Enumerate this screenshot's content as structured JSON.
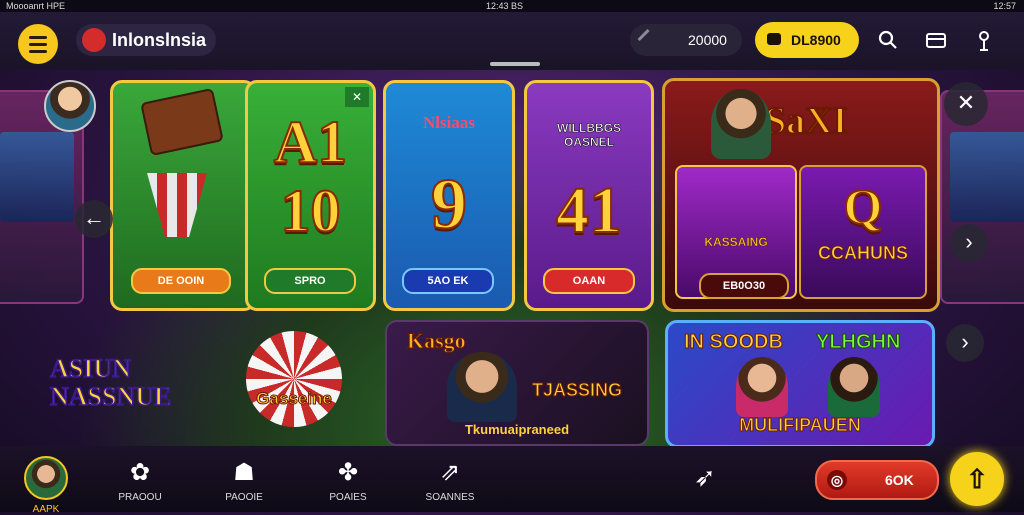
{
  "status_bar": {
    "left": "Moooanrt HPE",
    "center": "12:43 BS",
    "right": "12:57"
  },
  "header": {
    "brand": "Inlonslnsia",
    "coins": "20000",
    "gold_balance": "DL8900",
    "icons": [
      "search-icon",
      "wallet-icon",
      "info-icon"
    ]
  },
  "games_top": [
    {
      "id": "dice",
      "button": "DE OOIN",
      "colors": {
        "bg": "#2e8a2a",
        "btn": "#e87a1a"
      }
    },
    {
      "id": "green",
      "big": "A1 10",
      "button": "SPRO",
      "colors": {
        "bg": "#2a9a2a",
        "btn": "#1f7a2a"
      }
    },
    {
      "id": "blue",
      "title": "Nlsiaas",
      "big": "9",
      "button": "5AO EK",
      "colors": {
        "bg": "#1e8ad6",
        "btn": "#1a3ab0"
      }
    },
    {
      "id": "purple",
      "title": "WILLBBGS OASNEL",
      "big": "41",
      "button": "OAAN",
      "colors": {
        "bg": "#7a2ab0",
        "btn": "#d82a2a"
      }
    }
  ],
  "featured": {
    "title": "SaXI",
    "left_label": "KASSAING",
    "right_label": "CCAHUNS",
    "right_big": "Q",
    "button": "EB0O30"
  },
  "games_bottom": [
    {
      "id": "asian",
      "title": "ASIUN NASSNUE",
      "badge": "Gasseine"
    },
    {
      "id": "kasgo",
      "title": "Kasgo",
      "sub": "TJASSING",
      "footer": "Tkumuaipraneed"
    },
    {
      "id": "multi",
      "title_left": "IN SOODB",
      "title_right": "YLHGHN",
      "footer": "MULIFIPAUEN"
    }
  ],
  "bottom_nav": [
    {
      "label": "AAPK",
      "icon": "avatar-icon",
      "active": true
    },
    {
      "label": "PRAOOU",
      "icon": "gift-icon",
      "active": false
    },
    {
      "label": "PAOOIE",
      "icon": "profile-icon",
      "active": false
    },
    {
      "label": "POAIES",
      "icon": "chip-icon",
      "active": false
    },
    {
      "label": "SOANNES",
      "icon": "share-icon",
      "active": false
    }
  ],
  "bottom_right": {
    "balance": "6OK",
    "fab_icon": "arrow-up-icon"
  }
}
